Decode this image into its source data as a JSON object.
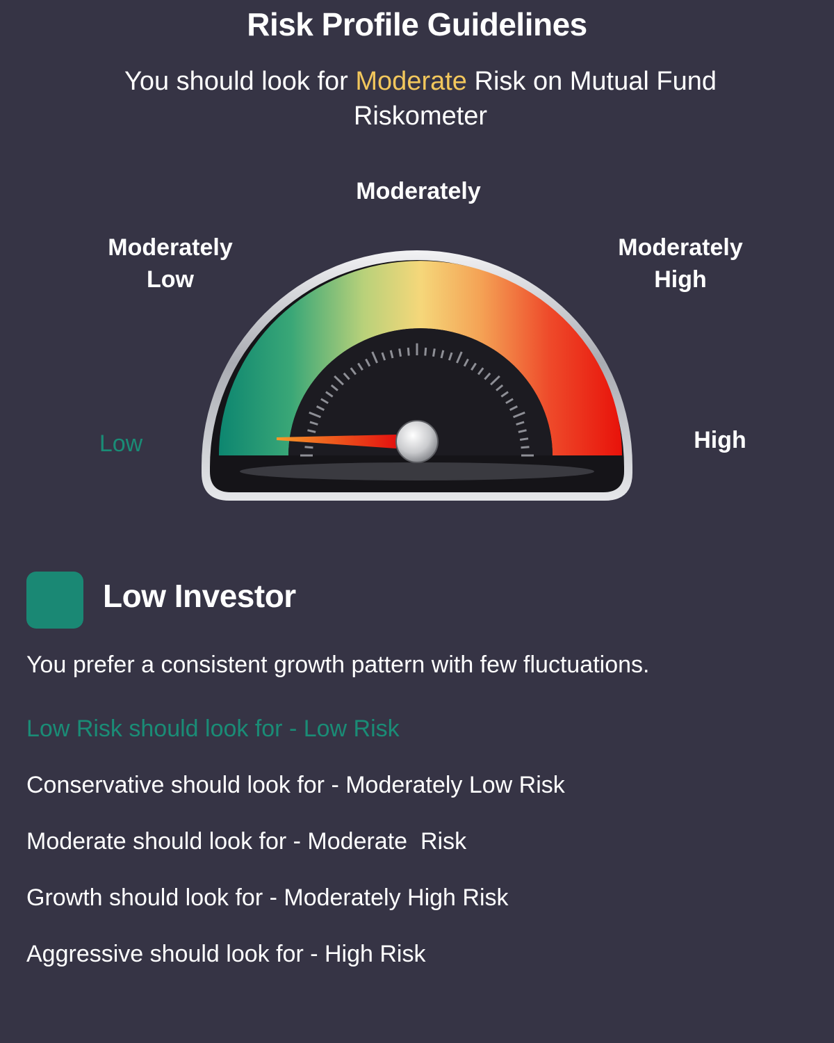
{
  "header": {
    "title": "Risk Profile Guidelines",
    "subtitle_prefix": "You should look for",
    "subtitle_highlight": "Moderate",
    "subtitle_suffix": "Risk on Mutual Fund Riskometer",
    "highlight_color": "#f2c75c"
  },
  "gauge": {
    "labels": {
      "low": "Low",
      "moderately_low_line1": "Moderately",
      "moderately_low_line2": "Low",
      "moderate": "Moderately",
      "moderately_high_line1": "Moderately",
      "moderately_high_line2": "High",
      "high": "High"
    },
    "needle_level": "Low",
    "colors": {
      "low": "#0d8670",
      "moderate": "#f5d77a",
      "high": "#e8120a"
    }
  },
  "profile": {
    "name": "Low Investor",
    "swatch_color": "#1a8874",
    "description": "You prefer a consistent growth pattern with few fluctuations."
  },
  "guidelines": [
    {
      "text": "Low Risk should look for - Low Risk",
      "active": true
    },
    {
      "text": "Conservative should look for - Moderately Low Risk",
      "active": false
    },
    {
      "text": "Moderate should look for - Moderate  Risk",
      "active": false
    },
    {
      "text": "Growth should look for - Moderately High Risk",
      "active": false
    },
    {
      "text": "Aggressive should look for - High Risk",
      "active": false
    }
  ]
}
